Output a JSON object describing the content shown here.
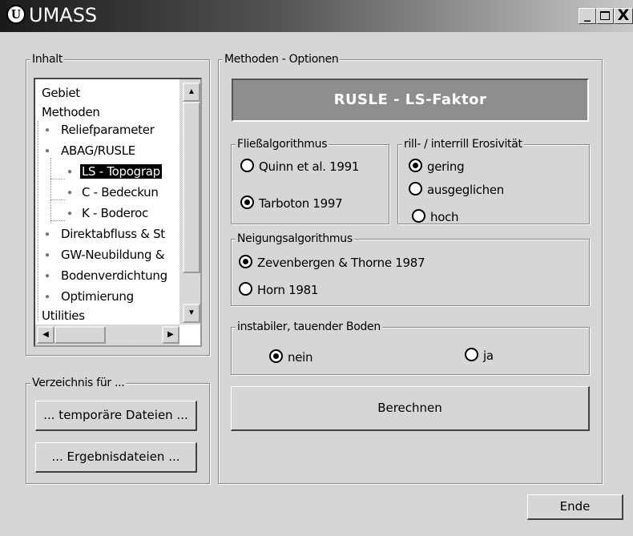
{
  "window": {
    "title": "UMASS",
    "logo_letter": "U",
    "min_glyph": "_",
    "close_glyph": "X"
  },
  "inhalt": {
    "title": "Inhalt",
    "tree": {
      "items": [
        "Gebiet",
        "Methoden",
        "Reliefparameter",
        "ABAG/RUSLE",
        "LS - Topograp",
        "C - Bedeckun",
        "K - Boderoc",
        "Direktabfluss & St",
        "GW-Neubildung &",
        "Bodenverdichtung",
        "Optimierung",
        "Utilities"
      ],
      "selected_index": 4
    },
    "scroll_up": "▲",
    "scroll_down": "▼",
    "scroll_left": "◀",
    "scroll_right": "▶"
  },
  "verzeichnis": {
    "title": "Verzeichnis für ...",
    "temp_button": "... temporäre Dateien ...",
    "results_button": "... Ergebnisdateien ..."
  },
  "methoden": {
    "title": "Methoden - Optionen",
    "banner": "RUSLE - LS-Faktor",
    "fliess": {
      "title": "Fließalgorithmus",
      "options": [
        "Quinn et al. 1991",
        "Tarboton 1997"
      ],
      "selected": 1
    },
    "erosiv": {
      "title": "rill- / interrill Erosivität",
      "options": [
        "gering",
        "ausgeglichen",
        "hoch"
      ],
      "selected": 0
    },
    "neigung": {
      "title": "Neigungsalgorithmus",
      "options": [
        "Zevenbergen & Thorne 1987",
        "Horn 1981"
      ],
      "selected": 0
    },
    "boden": {
      "title": "instabiler, tauender Boden",
      "options": [
        "nein",
        "ja"
      ],
      "selected": 0
    },
    "berechnen": "Berechnen"
  },
  "ende": "Ende"
}
